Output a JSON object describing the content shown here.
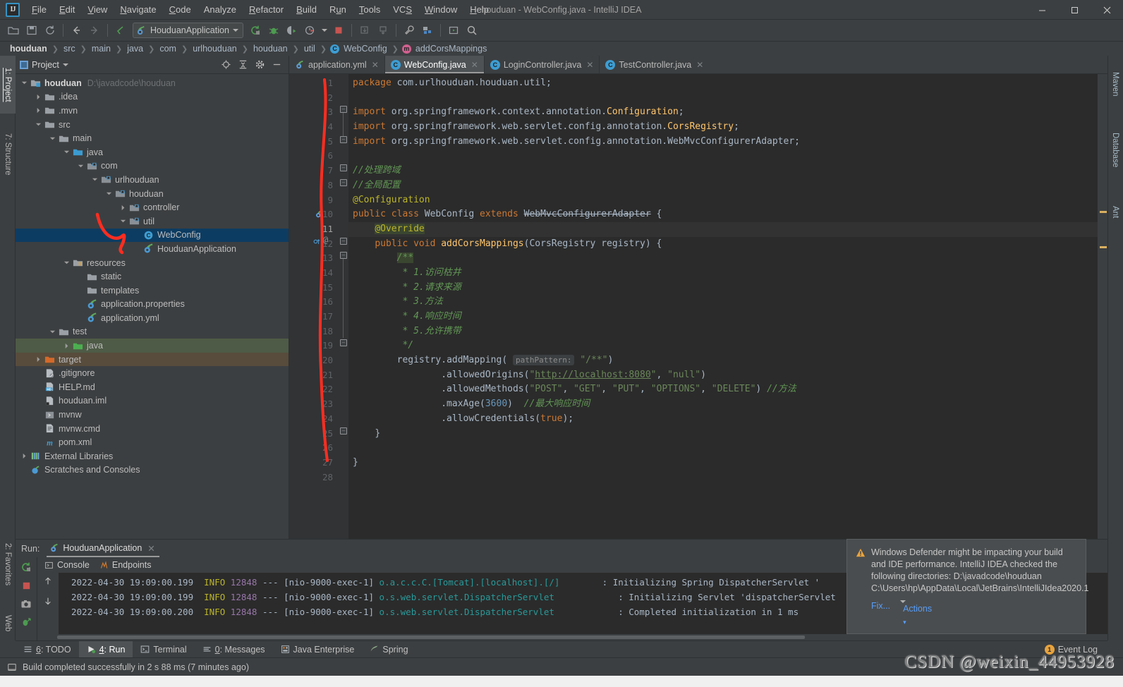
{
  "window": {
    "title": "houduan - WebConfig.java - IntelliJ IDEA",
    "logo": "IJ",
    "minimize": "—",
    "maximize": "☐",
    "close": "✕"
  },
  "menu": [
    {
      "label": "File"
    },
    {
      "label": "Edit"
    },
    {
      "label": "View"
    },
    {
      "label": "Navigate"
    },
    {
      "label": "Code"
    },
    {
      "label": "Analyze"
    },
    {
      "label": "Refactor"
    },
    {
      "label": "Build"
    },
    {
      "label": "Run"
    },
    {
      "label": "Tools"
    },
    {
      "label": "VCS"
    },
    {
      "label": "Window"
    },
    {
      "label": "Help"
    }
  ],
  "toolbar": {
    "run_config": "HouduanApplication",
    "icons": [
      "open-folder-icon",
      "save-icon",
      "sync-icon",
      "back-arrow-icon",
      "forward-arrow-icon",
      "undo-icon",
      "run-icon",
      "debug-icon",
      "run-coverage-icon",
      "profile-icon",
      "stop-icon",
      "update-project-icon",
      "commit-icon",
      "settings-wrench-icon",
      "project-structure-icon",
      "select-in-icon",
      "search-icon"
    ]
  },
  "breadcrumb": [
    {
      "label": "houduan",
      "icon": null
    },
    {
      "label": "src",
      "icon": null
    },
    {
      "label": "main",
      "icon": null
    },
    {
      "label": "java",
      "icon": null
    },
    {
      "label": "com",
      "icon": null
    },
    {
      "label": "urlhouduan",
      "icon": null
    },
    {
      "label": "houduan",
      "icon": null
    },
    {
      "label": "util",
      "icon": null
    },
    {
      "label": "WebConfig",
      "icon": "class-icon"
    },
    {
      "label": "addCorsMappings",
      "icon": "method-icon"
    }
  ],
  "left_strip": [
    {
      "label": "1: Project",
      "key": "1",
      "icon": "folder-icon",
      "active": true
    },
    {
      "label": "7: Structure",
      "key": "7",
      "icon": "structure-icon",
      "active": false
    },
    {
      "label": "2: Favorites",
      "key": "2",
      "icon": "star-icon",
      "active": false
    },
    {
      "label": "Web",
      "key": "",
      "icon": "globe-icon",
      "active": false
    }
  ],
  "right_strip": [
    {
      "label": "Maven",
      "icon": "maven-icon"
    },
    {
      "label": "Database",
      "icon": "database-icon"
    },
    {
      "label": "Ant",
      "icon": "ant-icon"
    }
  ],
  "project_panel": {
    "title": "Project",
    "tools": [
      "locate-icon",
      "collapse-all-icon",
      "settings-gear-icon",
      "hide-icon"
    ],
    "tree": [
      {
        "indent": 0,
        "arrow": "down",
        "icon": "module-folder",
        "label": "houduan",
        "bold": true,
        "sub": "D:\\javadcode\\houduan",
        "state": "normal"
      },
      {
        "indent": 1,
        "arrow": "right",
        "icon": "folder",
        "label": ".idea",
        "bold": false,
        "sub": "",
        "state": "normal"
      },
      {
        "indent": 1,
        "arrow": "right",
        "icon": "folder",
        "label": ".mvn",
        "bold": false,
        "sub": "",
        "state": "normal"
      },
      {
        "indent": 1,
        "arrow": "down",
        "icon": "folder",
        "label": "src",
        "bold": false,
        "sub": "",
        "state": "normal"
      },
      {
        "indent": 2,
        "arrow": "down",
        "icon": "folder",
        "label": "main",
        "bold": false,
        "sub": "",
        "state": "normal"
      },
      {
        "indent": 3,
        "arrow": "down",
        "icon": "folder-source",
        "label": "java",
        "bold": false,
        "sub": "",
        "state": "normal"
      },
      {
        "indent": 4,
        "arrow": "down",
        "icon": "package",
        "label": "com",
        "bold": false,
        "sub": "",
        "state": "normal"
      },
      {
        "indent": 5,
        "arrow": "down",
        "icon": "package",
        "label": "urlhouduan",
        "bold": false,
        "sub": "",
        "state": "normal"
      },
      {
        "indent": 6,
        "arrow": "down",
        "icon": "package",
        "label": "houduan",
        "bold": false,
        "sub": "",
        "state": "normal"
      },
      {
        "indent": 7,
        "arrow": "right",
        "icon": "package",
        "label": "controller",
        "bold": false,
        "sub": "",
        "state": "normal"
      },
      {
        "indent": 7,
        "arrow": "down",
        "icon": "package",
        "label": "util",
        "bold": false,
        "sub": "",
        "state": "normal"
      },
      {
        "indent": 8,
        "arrow": "none",
        "icon": "java-class",
        "label": "WebConfig",
        "bold": false,
        "sub": "",
        "state": "selected"
      },
      {
        "indent": 8,
        "arrow": "none",
        "icon": "spring-class",
        "label": "HouduanApplication",
        "bold": false,
        "sub": "",
        "state": "normal"
      },
      {
        "indent": 3,
        "arrow": "down",
        "icon": "folder-resources",
        "label": "resources",
        "bold": false,
        "sub": "",
        "state": "normal"
      },
      {
        "indent": 4,
        "arrow": "none",
        "icon": "folder",
        "label": "static",
        "bold": false,
        "sub": "",
        "state": "normal"
      },
      {
        "indent": 4,
        "arrow": "none",
        "icon": "folder",
        "label": "templates",
        "bold": false,
        "sub": "",
        "state": "normal"
      },
      {
        "indent": 4,
        "arrow": "none",
        "icon": "spring-file",
        "label": "application.properties",
        "bold": false,
        "sub": "",
        "state": "normal"
      },
      {
        "indent": 4,
        "arrow": "none",
        "icon": "spring-file",
        "label": "application.yml",
        "bold": false,
        "sub": "",
        "state": "normal"
      },
      {
        "indent": 2,
        "arrow": "down",
        "icon": "folder",
        "label": "test",
        "bold": false,
        "sub": "",
        "state": "normal"
      },
      {
        "indent": 3,
        "arrow": "right",
        "icon": "folder-test",
        "label": "java",
        "bold": false,
        "sub": "",
        "state": "green"
      },
      {
        "indent": 1,
        "arrow": "right",
        "icon": "folder-target",
        "label": "target",
        "bold": false,
        "sub": "",
        "state": "brown"
      },
      {
        "indent": 1,
        "arrow": "none",
        "icon": "gitignore-file",
        "label": ".gitignore",
        "bold": false,
        "sub": "",
        "state": "normal"
      },
      {
        "indent": 1,
        "arrow": "none",
        "icon": "md-file",
        "label": "HELP.md",
        "bold": false,
        "sub": "",
        "state": "normal"
      },
      {
        "indent": 1,
        "arrow": "none",
        "icon": "iml-file",
        "label": "houduan.iml",
        "bold": false,
        "sub": "",
        "state": "normal"
      },
      {
        "indent": 1,
        "arrow": "none",
        "icon": "script-file",
        "label": "mvnw",
        "bold": false,
        "sub": "",
        "state": "normal"
      },
      {
        "indent": 1,
        "arrow": "none",
        "icon": "cmd-file",
        "label": "mvnw.cmd",
        "bold": false,
        "sub": "",
        "state": "normal"
      },
      {
        "indent": 1,
        "arrow": "none",
        "icon": "maven-file",
        "label": "pom.xml",
        "bold": false,
        "sub": "",
        "state": "normal"
      },
      {
        "indent": 0,
        "arrow": "right",
        "icon": "libraries",
        "label": "External Libraries",
        "bold": false,
        "sub": "",
        "state": "normal"
      },
      {
        "indent": 0,
        "arrow": "none",
        "icon": "scratches",
        "label": "Scratches and Consoles",
        "bold": false,
        "sub": "",
        "state": "normal"
      }
    ]
  },
  "editor": {
    "tabs": [
      {
        "label": "application.yml",
        "icon": "spring-file-icon",
        "active": false
      },
      {
        "label": "WebConfig.java",
        "icon": "class-icon",
        "active": true
      },
      {
        "label": "LoginController.java",
        "icon": "class-icon",
        "active": false
      },
      {
        "label": "TestController.java",
        "icon": "class-icon",
        "active": false
      }
    ],
    "line_numbers": [
      1,
      2,
      3,
      4,
      5,
      6,
      7,
      8,
      9,
      10,
      11,
      12,
      13,
      14,
      15,
      16,
      17,
      18,
      19,
      20,
      21,
      22,
      23,
      24,
      25,
      26,
      27,
      28
    ],
    "current_line": 11,
    "code_lines": [
      "package com.urlhouduan.houduan.util;",
      "",
      "import org.springframework.context.annotation.Configuration;",
      "import org.springframework.web.servlet.config.annotation.CorsRegistry;",
      "import org.springframework.web.servlet.config.annotation.WebMvcConfigurerAdapter;",
      "",
      "//处理跨域",
      "//全局配置",
      "@Configuration",
      "public class WebConfig extends WebMvcConfigurerAdapter {",
      "    @Override",
      "    public void addCorsMappings(CorsRegistry registry) {",
      "        /**",
      "         * 1.访问枯井",
      "         * 2.请求来源",
      "         * 3.方法",
      "         * 4.响应时间",
      "         * 5.允许携带",
      "         */",
      "        registry.addMapping( pathPattern: \"/**\")",
      "                .allowedOrigins(\"http://localhost:8080\", \"null\")",
      "                .allowedMethods(\"POST\", \"GET\", \"PUT\", \"OPTIONS\", \"DELETE\") //方法",
      "                .maxAge(3600)  //最大响应时间",
      "                .allowCredentials(true);",
      "    }",
      "",
      "}",
      ""
    ],
    "param_hint": "pathPattern:"
  },
  "run_panel": {
    "run_label": "Run:",
    "config_name": "HouduanApplication",
    "tabs": [
      {
        "label": "Console",
        "icon": "console-icon",
        "active": true
      },
      {
        "label": "Endpoints",
        "icon": "endpoints-icon",
        "active": false
      }
    ],
    "sidebar_icons": [
      "rerun-icon",
      "stop-icon",
      "camera-icon",
      "thread-dump-icon"
    ],
    "nav_icons": [
      "scroll-up-icon",
      "scroll-down-icon"
    ],
    "log_lines": [
      {
        "date": "2022-04-30 19:09:00.199",
        "level": "INFO",
        "pid": "12848",
        "dashes": "---",
        "thread": "[nio-9000-exec-1]",
        "logger": "o.a.c.c.C.[Tomcat].[localhost].[/]",
        "pad": 8,
        "message": ": Initializing Spring DispatcherServlet '"
      },
      {
        "date": "2022-04-30 19:09:00.199",
        "level": "INFO",
        "pid": "12848",
        "dashes": "---",
        "thread": "[nio-9000-exec-1]",
        "logger": "o.s.web.servlet.DispatcherServlet",
        "pad": 12,
        "message": ": Initializing Servlet 'dispatcherServlet"
      },
      {
        "date": "2022-04-30 19:09:00.200",
        "level": "INFO",
        "pid": "12848",
        "dashes": "---",
        "thread": "[nio-9000-exec-1]",
        "logger": "o.s.web.servlet.DispatcherServlet",
        "pad": 12,
        "message": ": Completed initialization in 1 ms"
      }
    ]
  },
  "notification": {
    "icon": "warning-icon",
    "text": "Windows Defender might be impacting your build and IDE performance. IntelliJ IDEA checked the following directories: D:\\javadcode\\houduan C:\\Users\\hp\\AppData\\Local\\JetBrains\\IntelliJIdea2020.1",
    "links": [
      {
        "label": "Fix...",
        "caret": false
      },
      {
        "label": "Actions",
        "caret": true
      }
    ]
  },
  "tool_tabs": [
    {
      "label": "6: TODO",
      "key": "6",
      "icon": "todo-icon",
      "active": false
    },
    {
      "label": "4: Run",
      "key": "4",
      "icon": "run-green-icon",
      "active": true
    },
    {
      "label": "Terminal",
      "key": "",
      "icon": "terminal-icon",
      "active": false
    },
    {
      "label": "0: Messages",
      "key": "0",
      "icon": "messages-icon",
      "active": false
    },
    {
      "label": "Java Enterprise",
      "key": "",
      "icon": "java-ee-icon",
      "active": false
    },
    {
      "label": "Spring",
      "key": "",
      "icon": "spring-leaf-icon",
      "active": false
    }
  ],
  "event_log": {
    "label": "Event Log",
    "count": "1"
  },
  "statusbar": {
    "icon": "build-icon",
    "message": "Build completed successfully in 2 s 88 ms (7 minutes ago)"
  },
  "watermark": "CSDN @weixin_44953928",
  "colors": {
    "accent": "#3592c4",
    "selection": "#0d3c62",
    "editor_bg": "#2b2b2b",
    "panel_bg": "#3c3f41",
    "keyword": "#cc7832",
    "string": "#6a8759",
    "comment": "#629755",
    "annotation": "#bbb529",
    "number": "#6897bb",
    "marker_red": "#ff3b30"
  }
}
